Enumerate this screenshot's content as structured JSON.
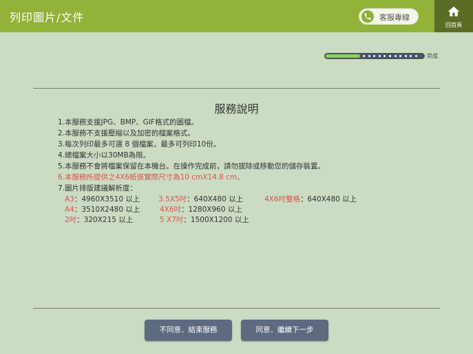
{
  "header": {
    "title": "列印圖片/文件",
    "customer_service_label": "客服專線",
    "home_label": "回首頁",
    "brand_color": "#93b23a"
  },
  "progress": {
    "label": "完成",
    "current_step": 1,
    "total_steps": 12,
    "fill_fraction": 0.35
  },
  "notice": {
    "title": "服務說明",
    "rules": [
      {
        "text": "1.本服務支援JPG、BMP、GIF格式的圖檔。",
        "highlight": false
      },
      {
        "text": "2.本服務不支援壓縮以及加密的檔案格式。",
        "highlight": false
      },
      {
        "text": "3.每次列印最多可選 8 個檔案，最多可列印10份。",
        "highlight": false
      },
      {
        "text": "4.總檔案大小以30MB為限。",
        "highlight": false
      },
      {
        "text": "5.本服務不會將檔案保留在本機台。在操作完成前，請勿拔除或移動您的儲存裝置。",
        "highlight": false
      },
      {
        "text": "6.本服務所提供之4X6紙張實際尺寸為10 cmX14.8 cm。",
        "highlight": true
      },
      {
        "text": "7.圖片排版建議解析度：",
        "highlight": false
      }
    ],
    "resolutions": [
      {
        "size": "A3",
        "value": "：4960X3510 以上"
      },
      {
        "size": "3.5X5吋",
        "value": "：640X480 以上"
      },
      {
        "size": "4X6吋雙格",
        "value": "：640X480 以上"
      },
      {
        "size": "A4",
        "value": "：3510X2480 以上"
      },
      {
        "size": "4X6吋",
        "value": "：1280X960 以上"
      },
      {
        "size": "2吋",
        "value": "：320X215 以上"
      },
      {
        "size": "5 X7吋",
        "value": "：1500X1200 以上"
      }
    ]
  },
  "buttons": {
    "disagree_label": "不同意．結束服務",
    "agree_label": "同意．繼續下一步"
  }
}
